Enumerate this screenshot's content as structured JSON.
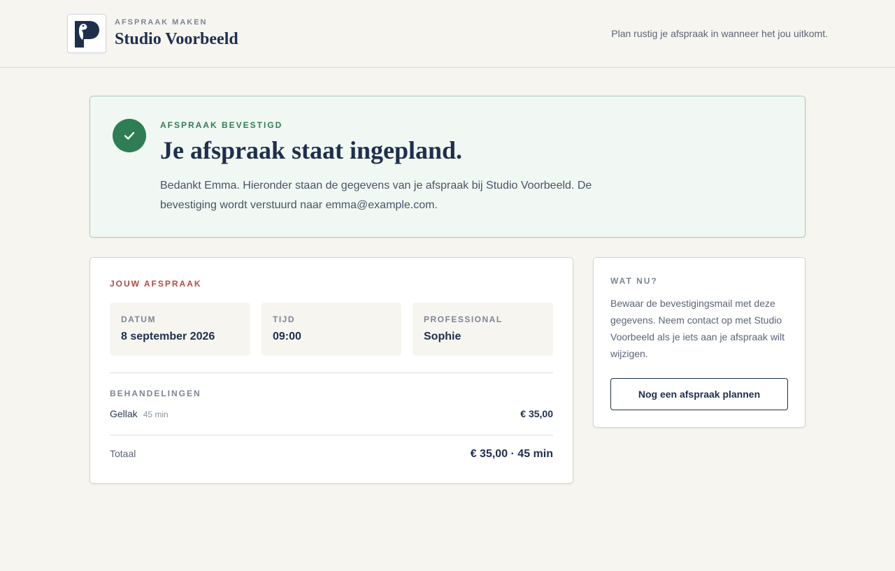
{
  "header": {
    "eyebrow": "AFSPRAAK MAKEN",
    "studio_name": "Studio Voorbeeld",
    "tagline": "Plan rustig je afspraak in wanneer het jou uitkomt.",
    "logo_icon": "pelican-p-logo-icon"
  },
  "confirmation": {
    "icon": "checkmark-icon",
    "eyebrow": "AFSPRAAK BEVESTIGD",
    "title": "Je afspraak staat ingepland.",
    "text": "Bedankt Emma. Hieronder staan de gegevens van je afspraak bij Studio Voorbeeld. De bevestiging wordt verstuurd naar emma@example.com."
  },
  "appointment": {
    "eyebrow": "JOUW AFSPRAAK",
    "details": [
      {
        "label": "DATUM",
        "value": "8 september 2026"
      },
      {
        "label": "TIJD",
        "value": "09:00"
      },
      {
        "label": "PROFESSIONAL",
        "value": "Sophie"
      }
    ],
    "treatments_label": "BEHANDELINGEN",
    "treatments": [
      {
        "name": "Gellak",
        "duration": "45 min",
        "price": "€ 35,00"
      }
    ],
    "total_label": "Totaal",
    "total_value": "€ 35,00 · 45 min"
  },
  "next_steps": {
    "eyebrow": "WAT NU?",
    "text": "Bewaar de bevestigingsmail met deze gegevens. Neem contact op met Studio Voorbeeld als je iets aan je afspraak wilt wijzigen.",
    "button_label": "Nog een afspraak plannen"
  },
  "colors": {
    "background": "#f7f5f0",
    "navy": "#1e2f4d",
    "success_green": "#2e7d54",
    "accent_red": "#b14a45"
  }
}
